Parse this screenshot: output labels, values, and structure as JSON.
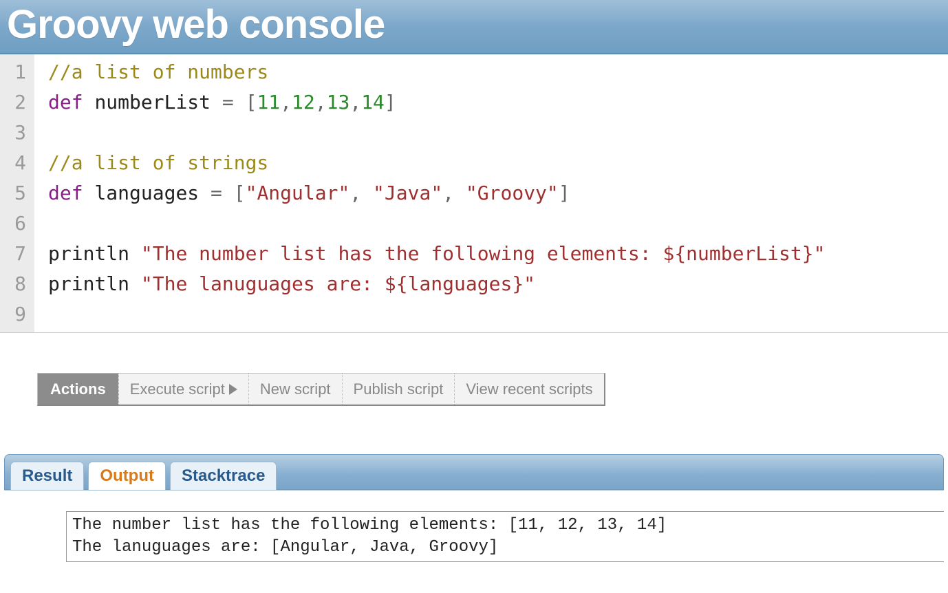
{
  "header": {
    "title": "Groovy web console"
  },
  "editor": {
    "line_numbers": [
      "1",
      "2",
      "3",
      "4",
      "5",
      "6",
      "7",
      "8",
      "9"
    ],
    "lines": [
      [
        {
          "cls": "c-comment",
          "t": "//a list of numbers"
        }
      ],
      [
        {
          "cls": "c-keyword",
          "t": "def"
        },
        {
          "cls": "",
          "t": " "
        },
        {
          "cls": "c-ident",
          "t": "numberList"
        },
        {
          "cls": "",
          "t": " "
        },
        {
          "cls": "c-punct",
          "t": "="
        },
        {
          "cls": "",
          "t": " "
        },
        {
          "cls": "c-bracket",
          "t": "["
        },
        {
          "cls": "c-number",
          "t": "11"
        },
        {
          "cls": "c-punct",
          "t": ","
        },
        {
          "cls": "c-number",
          "t": "12"
        },
        {
          "cls": "c-punct",
          "t": ","
        },
        {
          "cls": "c-number",
          "t": "13"
        },
        {
          "cls": "c-punct",
          "t": ","
        },
        {
          "cls": "c-number",
          "t": "14"
        },
        {
          "cls": "c-bracket",
          "t": "]"
        }
      ],
      [
        {
          "cls": "",
          "t": ""
        }
      ],
      [
        {
          "cls": "c-comment",
          "t": "//a list of strings"
        }
      ],
      [
        {
          "cls": "c-keyword",
          "t": "def"
        },
        {
          "cls": "",
          "t": " "
        },
        {
          "cls": "c-ident",
          "t": "languages"
        },
        {
          "cls": "",
          "t": " "
        },
        {
          "cls": "c-punct",
          "t": "="
        },
        {
          "cls": "",
          "t": " "
        },
        {
          "cls": "c-bracket",
          "t": "["
        },
        {
          "cls": "c-string",
          "t": "\"Angular\""
        },
        {
          "cls": "c-punct",
          "t": ","
        },
        {
          "cls": "",
          "t": " "
        },
        {
          "cls": "c-string",
          "t": "\"Java\""
        },
        {
          "cls": "c-punct",
          "t": ","
        },
        {
          "cls": "",
          "t": " "
        },
        {
          "cls": "c-string",
          "t": "\"Groovy\""
        },
        {
          "cls": "c-bracket",
          "t": "]"
        }
      ],
      [
        {
          "cls": "",
          "t": ""
        }
      ],
      [
        {
          "cls": "c-ident",
          "t": "println"
        },
        {
          "cls": "",
          "t": " "
        },
        {
          "cls": "c-string",
          "t": "\"The number list has the following elements: ${numberList}\""
        }
      ],
      [
        {
          "cls": "c-ident",
          "t": "println"
        },
        {
          "cls": "",
          "t": " "
        },
        {
          "cls": "c-string",
          "t": "\"The lanuguages are: ${languages}\""
        }
      ],
      [
        {
          "cls": "",
          "t": ""
        }
      ]
    ]
  },
  "actions": {
    "label": "Actions",
    "items": [
      {
        "label": "Execute script",
        "icon": "play"
      },
      {
        "label": "New script"
      },
      {
        "label": "Publish script"
      },
      {
        "label": "View recent scripts"
      }
    ]
  },
  "tabs": {
    "items": [
      {
        "label": "Result",
        "active": false
      },
      {
        "label": "Output",
        "active": true
      },
      {
        "label": "Stacktrace",
        "active": false
      }
    ]
  },
  "output": {
    "text": "The number list has the following elements: [11, 12, 13, 14]\nThe lanuguages are: [Angular, Java, Groovy]"
  }
}
